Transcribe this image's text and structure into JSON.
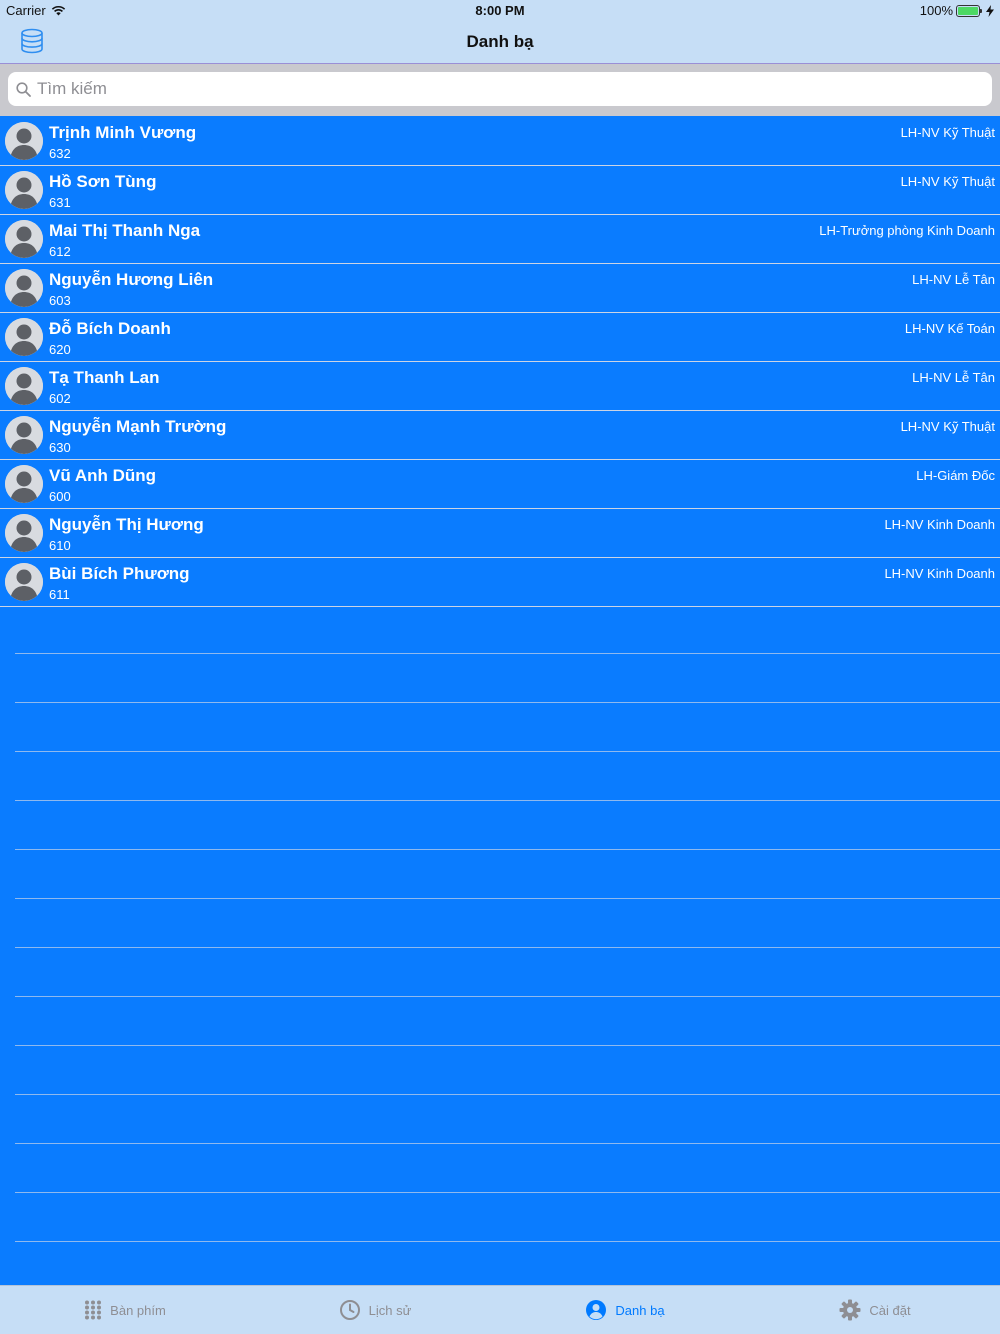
{
  "status": {
    "carrier": "Carrier",
    "time": "8:00 PM",
    "battery": "100%"
  },
  "nav": {
    "title": "Danh bạ"
  },
  "search": {
    "placeholder": "Tìm kiếm",
    "value": ""
  },
  "contacts": [
    {
      "name": "Trịnh Minh Vương",
      "ext": "632",
      "dept": "LH-NV Kỹ Thuật"
    },
    {
      "name": "Hồ Sơn Tùng",
      "ext": "631",
      "dept": "LH-NV Kỹ Thuật"
    },
    {
      "name": "Mai Thị Thanh Nga",
      "ext": "612",
      "dept": "LH-Trưởng phòng Kinh Doanh"
    },
    {
      "name": "Nguyễn Hương Liên",
      "ext": "603",
      "dept": "LH-NV Lễ Tân"
    },
    {
      "name": "Đỗ Bích Doanh",
      "ext": "620",
      "dept": "LH-NV Kế Toán"
    },
    {
      "name": "Tạ Thanh Lan",
      "ext": "602",
      "dept": "LH-NV Lễ Tân"
    },
    {
      "name": "Nguyễn Mạnh Trường",
      "ext": "630",
      "dept": "LH-NV Kỹ Thuật"
    },
    {
      "name": "Vũ Anh Dũng",
      "ext": "600",
      "dept": "LH-Giám Đốc"
    },
    {
      "name": "Nguyễn Thị Hương",
      "ext": "610",
      "dept": "LH-NV Kinh Doanh"
    },
    {
      "name": "Bùi Bích Phương",
      "ext": "611",
      "dept": "LH-NV Kinh Doanh"
    }
  ],
  "tabs": [
    {
      "label": "Bàn phím",
      "icon": "keypad-icon",
      "active": false
    },
    {
      "label": "Lịch sử",
      "icon": "clock-icon",
      "active": false
    },
    {
      "label": "Danh bạ",
      "icon": "contacts-icon",
      "active": true
    },
    {
      "label": "Cài đặt",
      "icon": "gear-icon",
      "active": false
    }
  ],
  "colors": {
    "list_background": "#0a7cff",
    "bar_background": "#c6def6",
    "accent": "#007aff",
    "inactive_tab": "#8e8e93"
  }
}
